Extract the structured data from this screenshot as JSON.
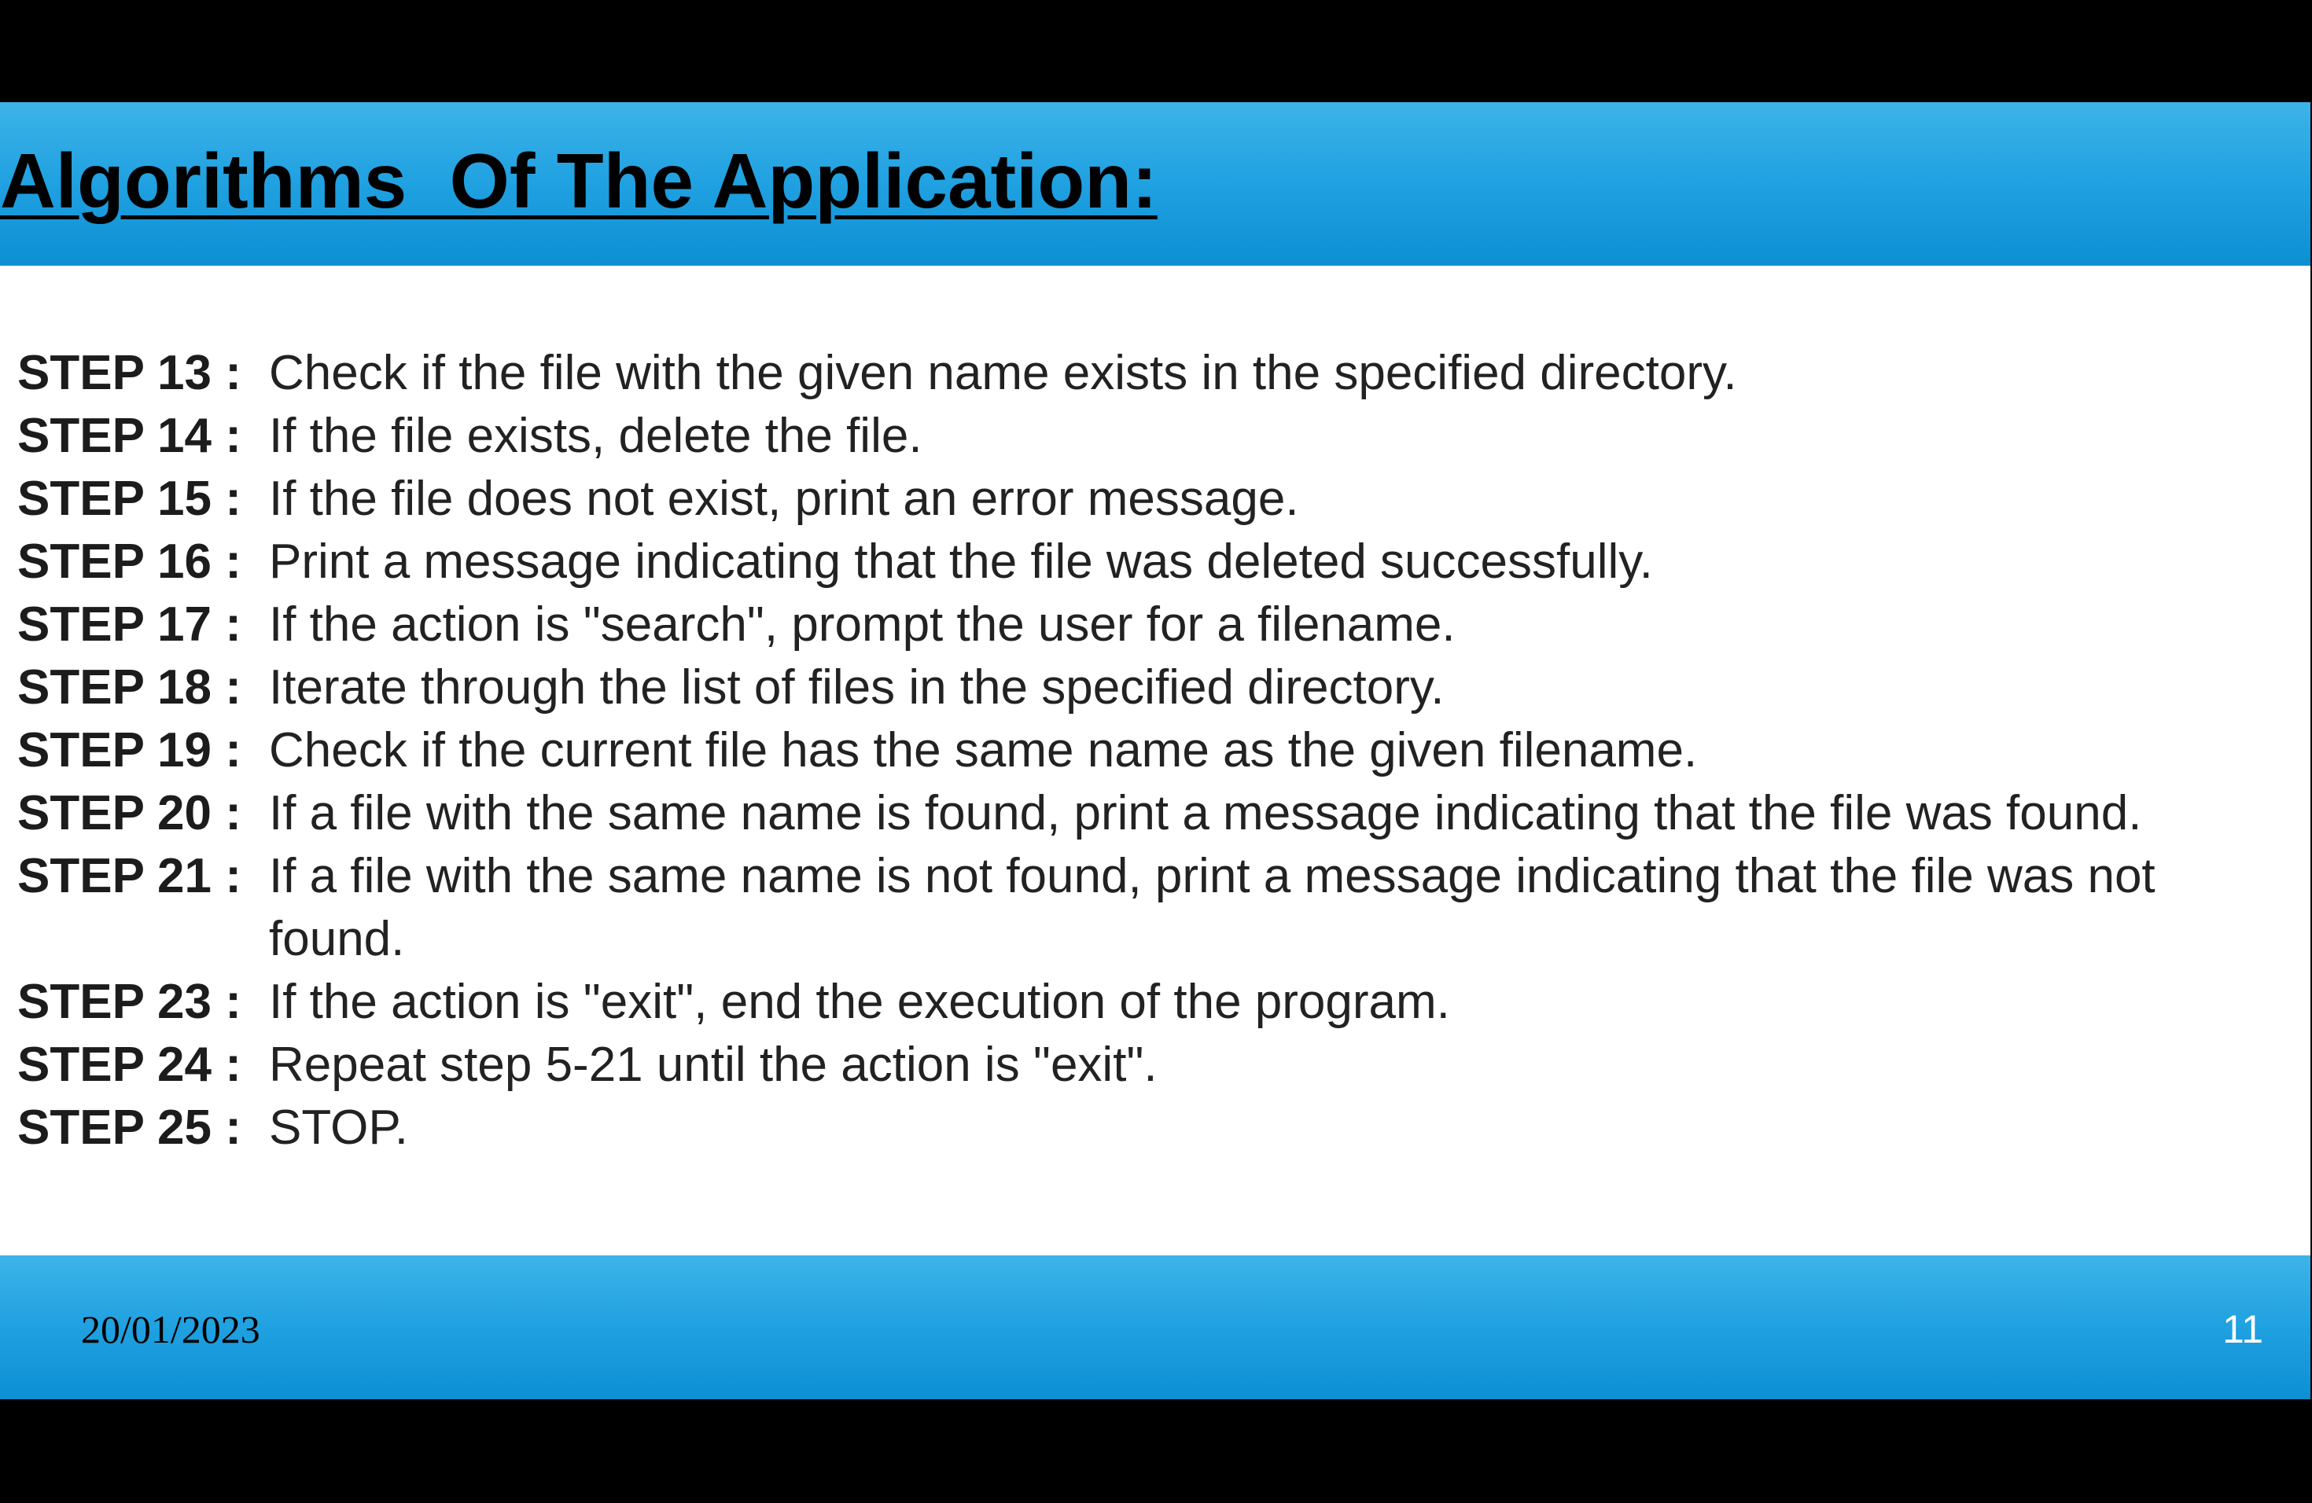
{
  "slide": {
    "title": "Algorithms  Of The Application:",
    "steps": [
      {
        "label": "STEP 13 : ",
        "text": "Check if the file with the given name exists in the specified directory."
      },
      {
        "label": "STEP 14 : ",
        "text": "If the file exists, delete the file."
      },
      {
        "label": "STEP 15 : ",
        "text": "If the file does not exist, print an error message."
      },
      {
        "label": "STEP 16 : ",
        "text": "Print a message indicating that the file was deleted successfully."
      },
      {
        "label": "STEP 17 : ",
        "text": "If the action is \"search\", prompt the user for a filename."
      },
      {
        "label": "STEP 18 : ",
        "text": "Iterate through the list of files in the specified directory."
      },
      {
        "label": "STEP 19 : ",
        "text": "Check if the current file has the same name as the given filename."
      },
      {
        "label": "STEP 20 : ",
        "text": "If a file with the same name is found, print a message indicating that the file was found."
      },
      {
        "label": "STEP 21 : ",
        "text": "If a file with the same name is not found, print a message indicating that the file was not found."
      },
      {
        "label": "STEP 23 : ",
        "text": "If the action is \"exit\", end the execution of the program."
      },
      {
        "label": "STEP 24 : ",
        "text": "Repeat step 5-21 until the action is \"exit\"."
      },
      {
        "label": "STEP 25 : ",
        "text": "STOP."
      }
    ],
    "footer": {
      "date": "20/01/2023",
      "page_number": "11"
    }
  },
  "colors": {
    "band_top": "#3db3e8",
    "band_bottom": "#0d8fd4",
    "background": "#000000",
    "slide": "#ffffff"
  }
}
